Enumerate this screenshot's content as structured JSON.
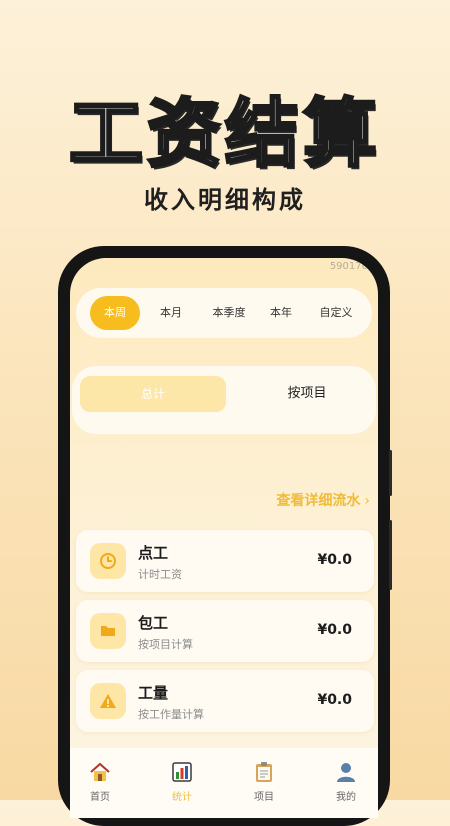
{
  "promo": {
    "headline": "工资结算",
    "subheadline": "收入明细构成"
  },
  "app": {
    "id_text": "590176",
    "period_tabs": [
      {
        "label": "本周",
        "active": true
      },
      {
        "label": "本月",
        "active": false
      },
      {
        "label": "本季度",
        "active": false
      },
      {
        "label": "本年",
        "active": false
      },
      {
        "label": "自定义",
        "active": false
      }
    ],
    "segment": {
      "left_label": "总计",
      "right_label": "按项目"
    },
    "detail_link": {
      "label": "查看详细流水",
      "arrow": "›"
    },
    "rows": [
      {
        "title": "点工",
        "subtitle": "计时工资",
        "amount": "¥0.0",
        "icon": "clock-icon"
      },
      {
        "title": "包工",
        "subtitle": "按项目计算",
        "amount": "¥0.0",
        "icon": "folder-icon"
      },
      {
        "title": "工量",
        "subtitle": "按工作量计算",
        "amount": "¥0.0",
        "icon": "warning-icon"
      }
    ],
    "nav": [
      {
        "label": "首页",
        "icon": "home-icon",
        "active": false
      },
      {
        "label": "统计",
        "icon": "chart-icon",
        "active": true
      },
      {
        "label": "项目",
        "icon": "clipboard-icon",
        "active": false
      },
      {
        "label": "我的",
        "icon": "user-icon",
        "active": false
      }
    ]
  },
  "colors": {
    "accent": "#f7bd1e",
    "accent_text": "#f1bb33",
    "icon_bg": "#fde6a6"
  }
}
